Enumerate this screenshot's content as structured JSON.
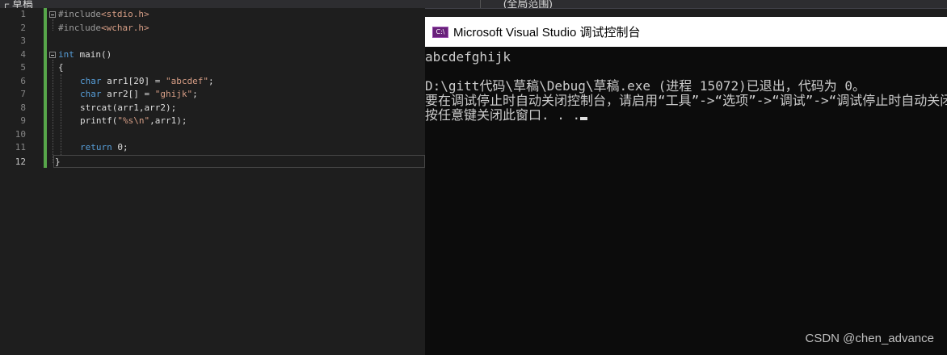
{
  "top_bar": {
    "left_fragment": "┌ 草稿",
    "right_fragment": "(全局范围)"
  },
  "editor": {
    "line_numbers": [
      "1",
      "2",
      "3",
      "4",
      "5",
      "6",
      "7",
      "8",
      "9",
      "10",
      "11",
      "12"
    ],
    "active_line": "12",
    "code": {
      "l1_include": "#include",
      "l1_header": "<stdio.h>",
      "l2_include": "#include",
      "l2_header": "<wchar.h>",
      "l4_type": "int",
      "l4_name": " main()",
      "l5": "{",
      "l6_type": "char",
      "l6_decl": " arr1[20] = ",
      "l6_str": "\"abcdef\"",
      "l6_end": ";",
      "l7_type": "char",
      "l7_decl": " arr2[] = ",
      "l7_str": "\"ghijk\"",
      "l7_end": ";",
      "l8": "strcat(arr1,arr2);",
      "l9_fn": "printf(",
      "l9_str": "\"%s\\n\"",
      "l9_end": ",arr1);",
      "l11_kw": "return",
      "l11_num": " 0",
      "l11_end": ";",
      "l12": "}"
    },
    "colors": {
      "keyword": "#569cd6",
      "string": "#d69d85",
      "preprocessor": "#9b9b9b",
      "change_bar": "#57a64a"
    }
  },
  "console": {
    "title": "Microsoft Visual Studio 调试控制台",
    "icon": "console-app-icon",
    "icon_text": "C:\\",
    "lines": [
      "abcdefghijk",
      "",
      "D:\\gitt代码\\草稿\\Debug\\草稿.exe (进程 15072)已退出，代码为 0。",
      "要在调试停止时自动关闭控制台，请启用“工具”->“选项”->“调试”->“调试停止时自动关闭控制台”。",
      "按任意键关闭此窗口. . ."
    ]
  },
  "watermark": "CSDN @chen_advance"
}
